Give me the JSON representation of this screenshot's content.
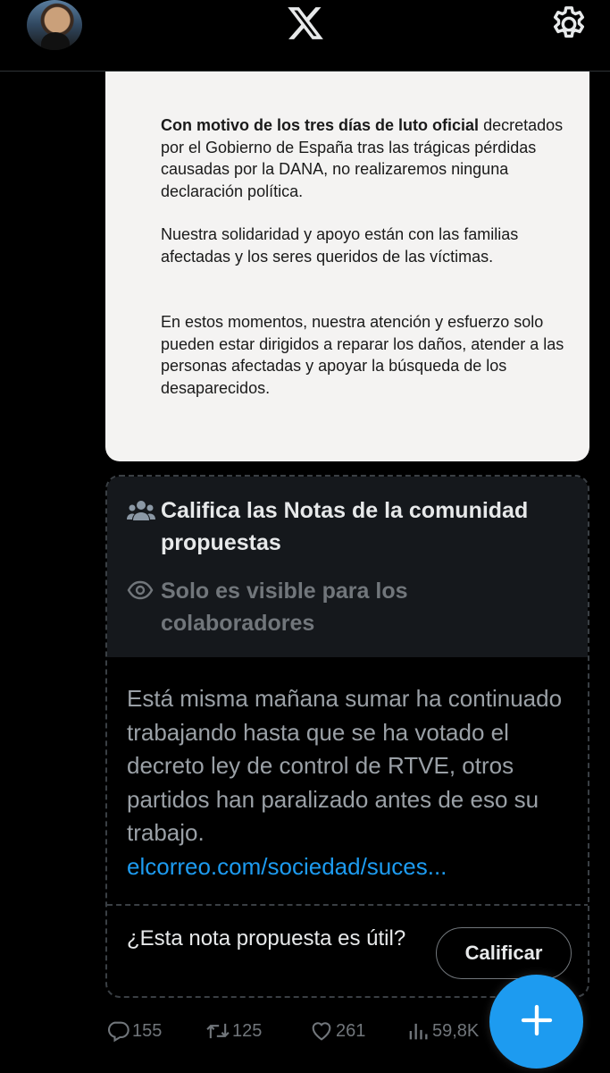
{
  "header": {
    "avatar_icon": "profile-avatar",
    "logo_icon": "x-logo-icon",
    "settings_icon": "gear-icon"
  },
  "statement": {
    "p1_bold": "Con motivo de los tres días de luto oficial",
    "p1_rest": "decretados por el Gobierno de España tras las trágicas pérdidas causadas por la DANA, no realizaremos ninguna declaración política.",
    "p2": "Nuestra solidaridad y apoyo están con las familias afectadas y los seres queridos de las víctimas.",
    "p3": "En estos momentos, nuestra atención y esfuerzo solo pueden estar dirigidos a reparar los daños, atender a las personas afectadas y apoyar la búsqueda de los desaparecidos."
  },
  "community_notes": {
    "title": "Califica las Notas de la comunidad propuestas",
    "visibility": "Solo es visible para los colaboradores",
    "note_text": "Está misma mañana sumar ha continuado trabajando hasta que se ha votado el decreto  ley de control de RTVE, otros partidos han paralizado antes de eso su trabajo.",
    "note_link": "elcorreo.com/sociedad/suces...",
    "question": "¿Esta nota propuesta es útil?",
    "rate_button": "Calificar"
  },
  "actions": {
    "replies": "155",
    "reposts": "125",
    "likes": "261",
    "views": "59,8K"
  },
  "colors": {
    "accent": "#1d9bf0",
    "background": "#000000",
    "muted": "#71767b"
  }
}
